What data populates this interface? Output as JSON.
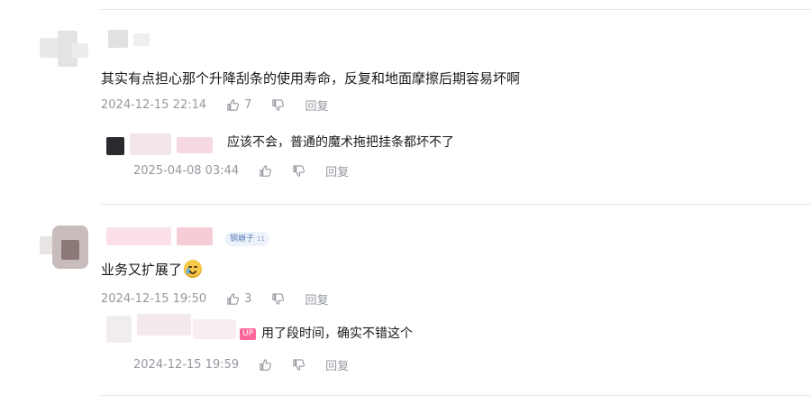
{
  "comments": [
    {
      "text": "其实有点担心那个升降刮条的使用寿命，反复和地面摩擦后期容易坏啊",
      "time": "2024-12-15 22:14",
      "like_count": "7",
      "reply_label": "回复",
      "replies": [
        {
          "text": "应该不会，普通的魔术拖把挂条都坏不了",
          "time": "2025-04-08 03:44",
          "reply_label": "回复"
        }
      ]
    },
    {
      "badge": "钢崩子",
      "badge_level": "11",
      "text": "业务又扩展了",
      "emoji": "sweat-smile-emoji",
      "time": "2024-12-15 19:50",
      "like_count": "3",
      "reply_label": "回复",
      "replies": [
        {
          "up_tag": "UP",
          "text": "用了段时间，确实不错这个",
          "time": "2024-12-15 19:59",
          "reply_label": "回复"
        }
      ]
    }
  ],
  "colors": {
    "text": "#18191c",
    "meta": "#9499a0",
    "divider": "#e3e5e7",
    "up_tag": "#ff6699",
    "badge_bg": "#eef3fb"
  },
  "icons": [
    "like-icon",
    "dislike-icon"
  ]
}
